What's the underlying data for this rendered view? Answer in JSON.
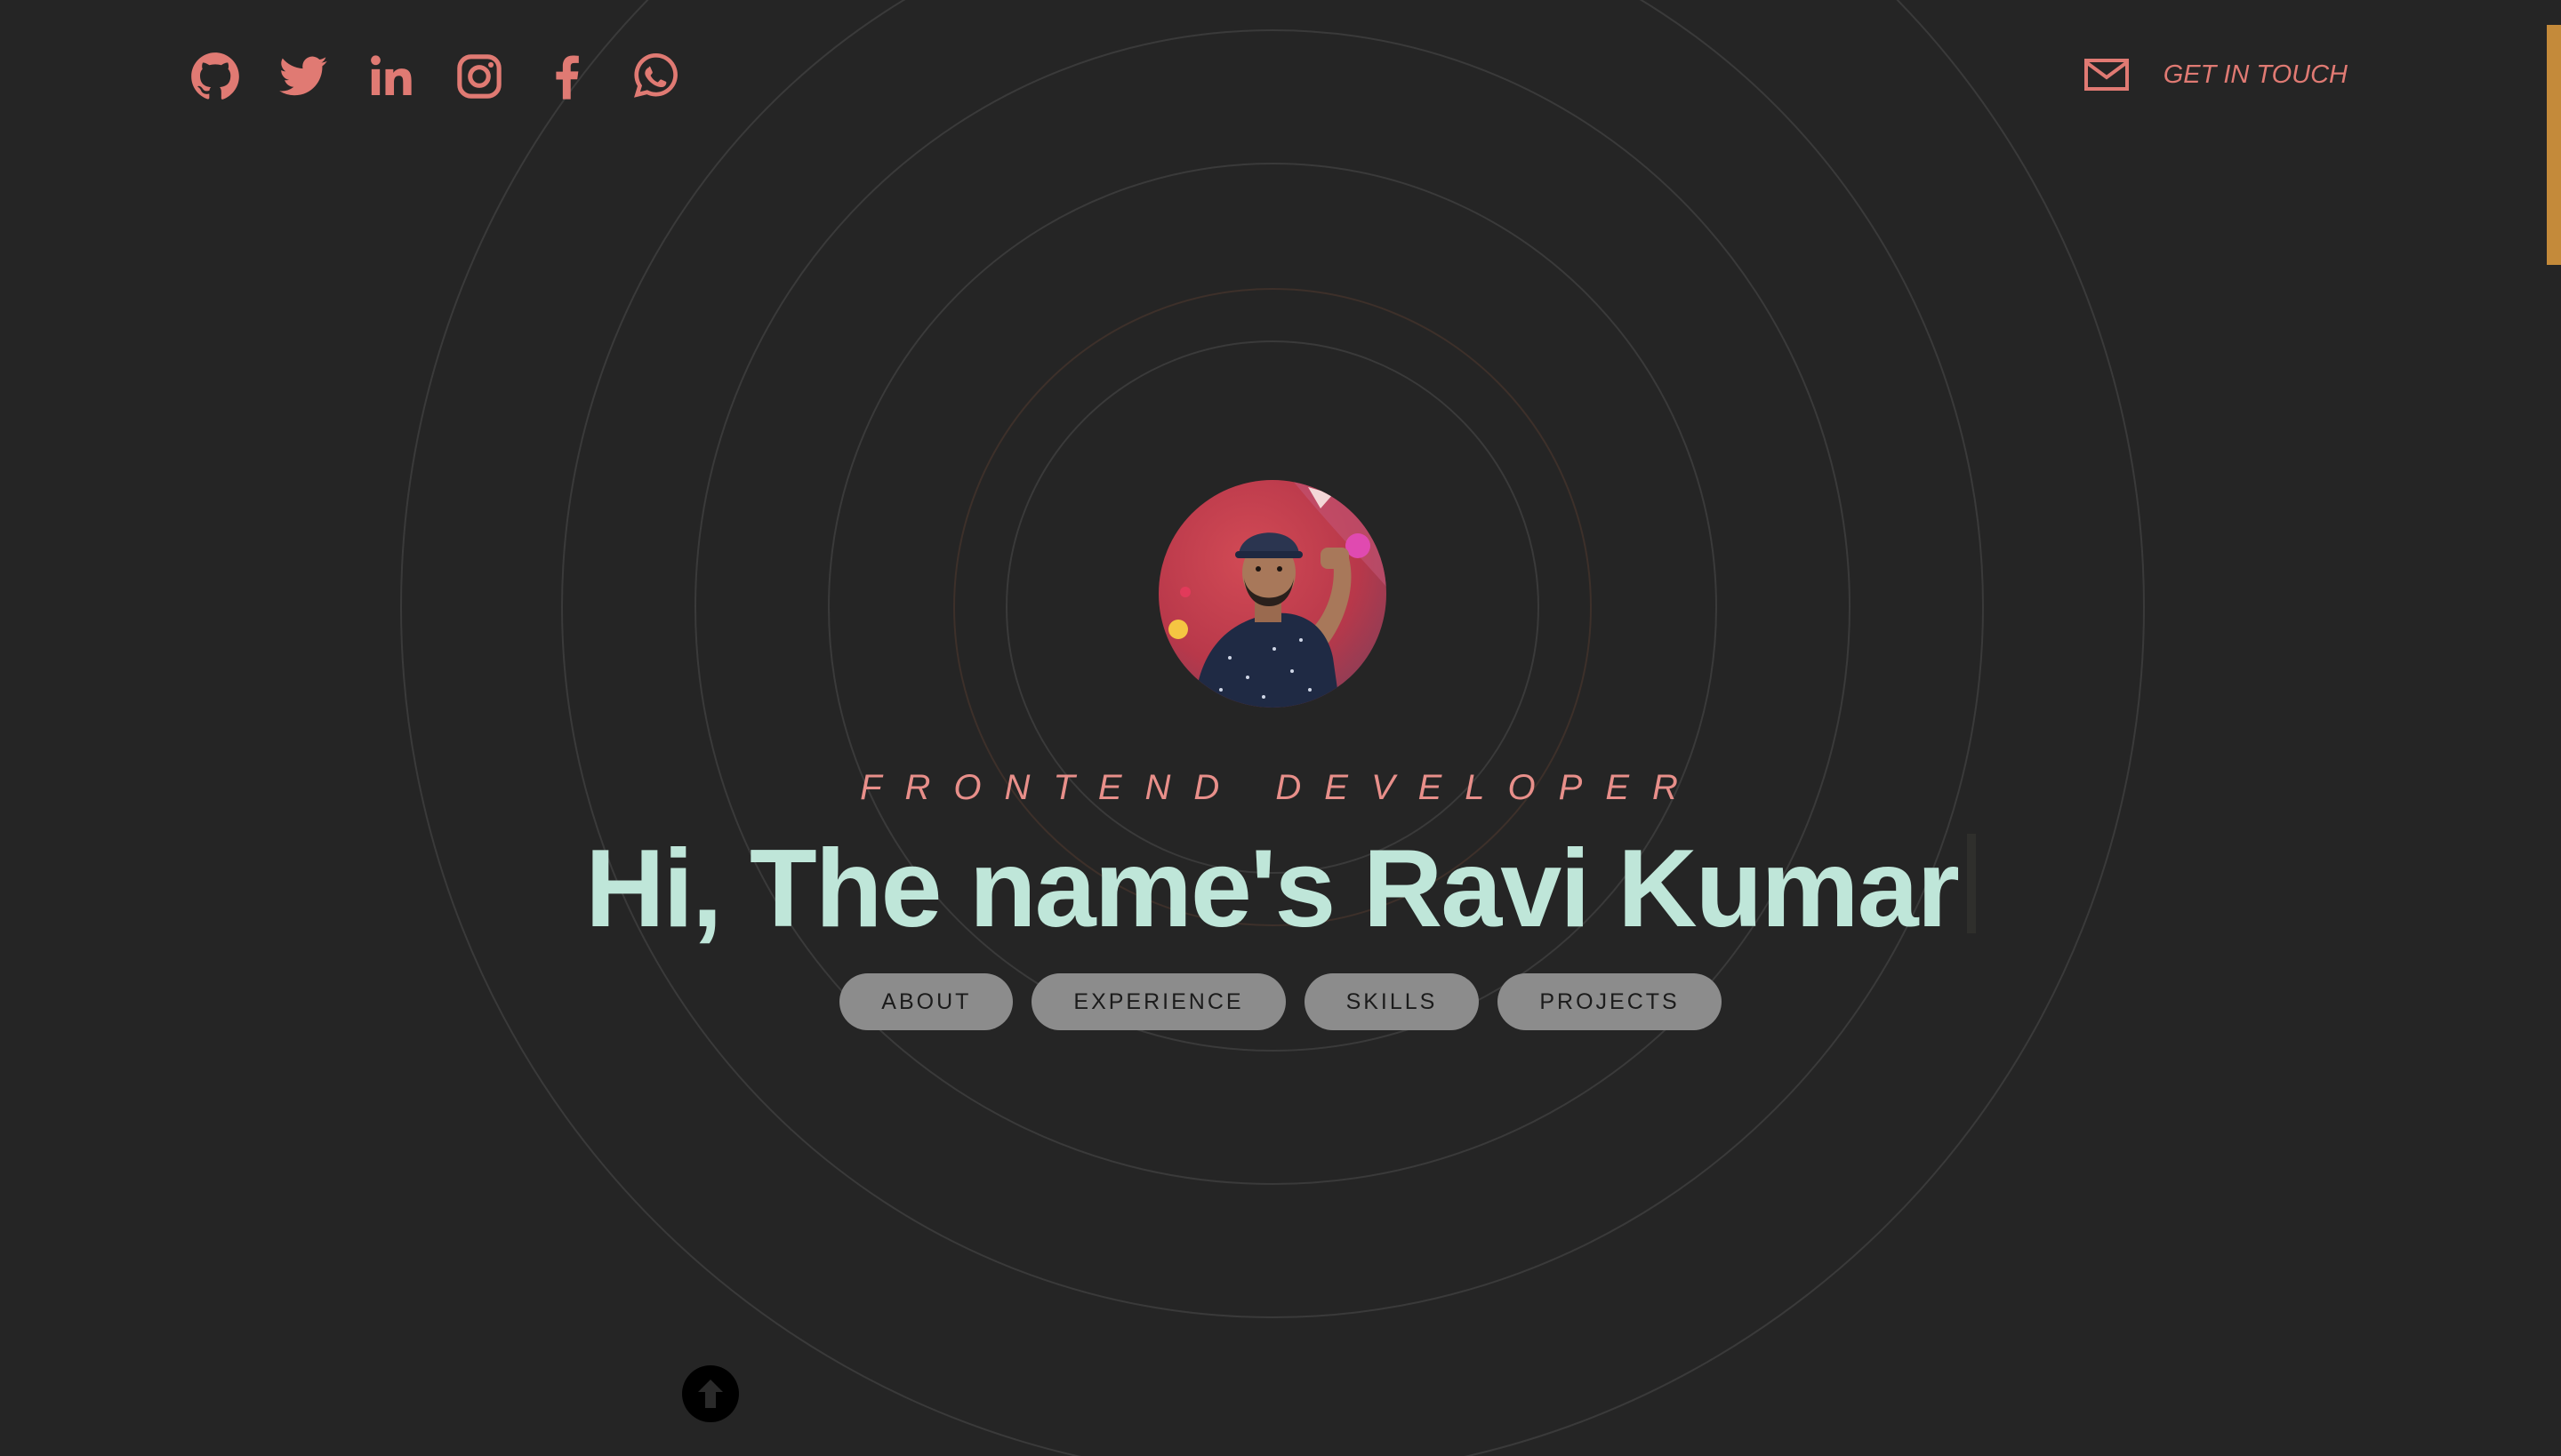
{
  "social": {
    "items": [
      {
        "name": "github",
        "icon": "github-icon"
      },
      {
        "name": "twitter",
        "icon": "twitter-icon"
      },
      {
        "name": "linkedin",
        "icon": "linkedin-icon"
      },
      {
        "name": "instagram",
        "icon": "instagram-icon"
      },
      {
        "name": "facebook",
        "icon": "facebook-icon"
      },
      {
        "name": "whatsapp",
        "icon": "whatsapp-icon"
      }
    ]
  },
  "contact": {
    "icon": "mail-icon",
    "label": "GET IN TOUCH"
  },
  "hero": {
    "role": "FRONTEND DEVELOPER",
    "headline": "Hi, The name's Ravi Kumar"
  },
  "nav": {
    "about": "ABOUT",
    "experience": "EXPERIENCE",
    "skills": "SKILLS",
    "projects": "PROJECTS"
  },
  "scroll_top": {
    "icon": "arrow-up-icon"
  },
  "colors": {
    "background": "#252525",
    "accent": "#e07a73",
    "headline": "#bfe6d9",
    "pill": "#8c8c8c",
    "scroll_progress": "#c48a3a"
  }
}
